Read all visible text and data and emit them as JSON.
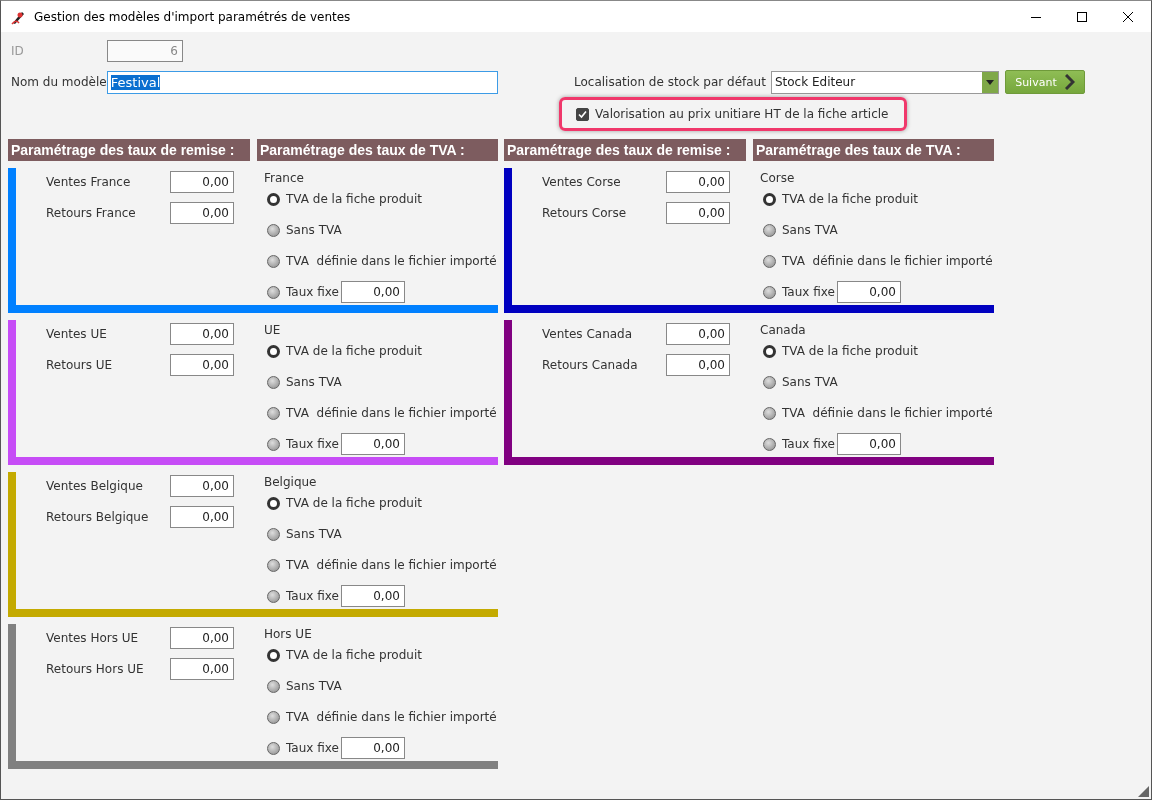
{
  "window": {
    "title": "Gestion des modèles d'import paramétrés de ventes"
  },
  "id_field": {
    "label": "ID",
    "value": "6",
    "disabled": true
  },
  "name_field": {
    "label": "Nom du modèle",
    "value": "Festival",
    "selected_text": true
  },
  "stock_location": {
    "label": "Localisation de stock par défaut",
    "value": "Stock Editeur"
  },
  "next_button": {
    "label": "Suivant"
  },
  "valuation_checkbox": {
    "label": "Valorisation au prix unitiare HT de la fiche article",
    "checked": true,
    "highlighted": true
  },
  "columns": [
    {
      "headers": [
        "Paramétrage des taux de remise :",
        "Paramétrage des taux de TVA :"
      ],
      "sections": [
        {
          "color": "#0080ff",
          "rates": [
            {
              "label": "Ventes France",
              "value": "0,00"
            },
            {
              "label": "Retours France",
              "value": "0,00"
            }
          ],
          "vat_title": "France",
          "vat_options": [
            {
              "kind": "radio",
              "label": "TVA de la fiche produit",
              "selected": true
            },
            {
              "kind": "radio",
              "label": "Sans TVA",
              "selected": false
            },
            {
              "kind": "radio",
              "label": "TVA  définie dans le fichier importé",
              "selected": false
            },
            {
              "kind": "fixed",
              "label": "Taux fixe",
              "selected": false,
              "value": "0,00"
            }
          ]
        },
        {
          "color": "#c64cf6",
          "rates": [
            {
              "label": "Ventes UE",
              "value": "0,00"
            },
            {
              "label": "Retours UE",
              "value": "0,00"
            }
          ],
          "vat_title": "UE",
          "vat_options": [
            {
              "kind": "radio",
              "label": "TVA de la fiche produit",
              "selected": true
            },
            {
              "kind": "radio",
              "label": "Sans TVA",
              "selected": false
            },
            {
              "kind": "radio",
              "label": "TVA  définie dans le fichier importé",
              "selected": false
            },
            {
              "kind": "fixed",
              "label": "Taux fixe",
              "selected": false,
              "value": "0,00"
            }
          ]
        },
        {
          "color": "#c4aa00",
          "rates": [
            {
              "label": "Ventes Belgique",
              "value": "0,00"
            },
            {
              "label": "Retours Belgique",
              "value": "0,00"
            }
          ],
          "vat_title": "Belgique",
          "vat_options": [
            {
              "kind": "radio",
              "label": "TVA de la fiche produit",
              "selected": true
            },
            {
              "kind": "radio",
              "label": "Sans TVA",
              "selected": false
            },
            {
              "kind": "radio",
              "label": "TVA  définie dans le fichier importé",
              "selected": false
            },
            {
              "kind": "fixed",
              "label": "Taux fixe",
              "selected": false,
              "value": "0,00"
            }
          ]
        },
        {
          "color": "#808080",
          "rates": [
            {
              "label": "Ventes Hors UE",
              "value": "0,00"
            },
            {
              "label": "Retours Hors UE",
              "value": "0,00"
            }
          ],
          "vat_title": "Hors UE",
          "vat_options": [
            {
              "kind": "radio",
              "label": "TVA de la fiche produit",
              "selected": true
            },
            {
              "kind": "radio",
              "label": "Sans TVA",
              "selected": false
            },
            {
              "kind": "radio",
              "label": "TVA  définie dans le fichier importé",
              "selected": false
            },
            {
              "kind": "fixed",
              "label": "Taux fixe",
              "selected": false,
              "value": "0,00"
            }
          ]
        }
      ]
    },
    {
      "headers": [
        "Paramétrage des taux de remise :",
        "Paramétrage des taux de TVA :"
      ],
      "sections": [
        {
          "color": "#0000c0",
          "rates": [
            {
              "label": "Ventes Corse",
              "value": "0,00"
            },
            {
              "label": "Retours Corse",
              "value": "0,00"
            }
          ],
          "vat_title": "Corse",
          "vat_options": [
            {
              "kind": "radio",
              "label": "TVA de la fiche produit",
              "selected": true
            },
            {
              "kind": "radio",
              "label": "Sans TVA",
              "selected": false
            },
            {
              "kind": "radio",
              "label": "TVA  définie dans le fichier importé",
              "selected": false
            },
            {
              "kind": "fixed",
              "label": "Taux fixe",
              "selected": false,
              "value": "0,00"
            }
          ]
        },
        {
          "color": "#800080",
          "rates": [
            {
              "label": "Ventes Canada",
              "value": "0,00"
            },
            {
              "label": "Retours Canada",
              "value": "0,00"
            }
          ],
          "vat_title": "Canada",
          "vat_options": [
            {
              "kind": "radio",
              "label": "TVA de la fiche produit",
              "selected": true
            },
            {
              "kind": "radio",
              "label": "Sans TVA",
              "selected": false
            },
            {
              "kind": "radio",
              "label": "TVA  définie dans le fichier importé",
              "selected": false
            },
            {
              "kind": "fixed",
              "label": "Taux fixe",
              "selected": false,
              "value": "0,00"
            }
          ]
        }
      ]
    }
  ]
}
